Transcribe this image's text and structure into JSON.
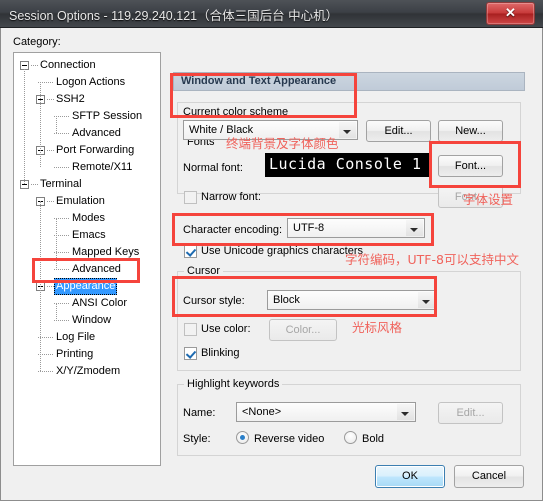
{
  "window": {
    "title": "Session Options - 119.29.240.121（合体三国后台 中心机）",
    "close_label": "✕",
    "close_icon": "close-icon"
  },
  "category": {
    "label": "Category:",
    "items": [
      {
        "label": "Connection",
        "indent": 0,
        "expander": true,
        "selected": false
      },
      {
        "label": "Logon Actions",
        "indent": 1,
        "expander": false,
        "selected": false
      },
      {
        "label": "SSH2",
        "indent": 1,
        "expander": true,
        "selected": false
      },
      {
        "label": "SFTP Session",
        "indent": 2,
        "expander": false,
        "selected": false
      },
      {
        "label": "Advanced",
        "indent": 2,
        "expander": false,
        "selected": false
      },
      {
        "label": "Port Forwarding",
        "indent": 1,
        "expander": true,
        "selected": false
      },
      {
        "label": "Remote/X11",
        "indent": 2,
        "expander": false,
        "selected": false
      },
      {
        "label": "Terminal",
        "indent": 0,
        "expander": true,
        "selected": false
      },
      {
        "label": "Emulation",
        "indent": 1,
        "expander": true,
        "selected": false
      },
      {
        "label": "Modes",
        "indent": 2,
        "expander": false,
        "selected": false
      },
      {
        "label": "Emacs",
        "indent": 2,
        "expander": false,
        "selected": false
      },
      {
        "label": "Mapped Keys",
        "indent": 2,
        "expander": false,
        "selected": false
      },
      {
        "label": "Advanced",
        "indent": 2,
        "expander": false,
        "selected": false
      },
      {
        "label": "Appearance",
        "indent": 1,
        "expander": true,
        "selected": true
      },
      {
        "label": "ANSI Color",
        "indent": 2,
        "expander": false,
        "selected": false
      },
      {
        "label": "Window",
        "indent": 2,
        "expander": false,
        "selected": false
      },
      {
        "label": "Log File",
        "indent": 1,
        "expander": false,
        "selected": false
      },
      {
        "label": "Printing",
        "indent": 1,
        "expander": false,
        "selected": false
      },
      {
        "label": "X/Y/Zmodem",
        "indent": 1,
        "expander": false,
        "selected": false
      }
    ]
  },
  "pane": {
    "header": "Window and Text Appearance",
    "color_scheme": {
      "group_label": "Current color scheme",
      "value": "White / Black",
      "edit_button": "Edit...",
      "new_button": "New..."
    },
    "fonts": {
      "group_label": "Fonts",
      "normal_font_label": "Normal font:",
      "normal_font_preview": "Lucida Console 1",
      "font_button": "Font...",
      "narrow_font_label": "Narrow font:",
      "narrow_font_checked": false,
      "narrow_font_button": "Font...",
      "encoding_label": "Character encoding:",
      "encoding_value": "UTF-8",
      "unicode_graphics_label": "Use Unicode graphics characters",
      "unicode_graphics_checked": true
    },
    "cursor": {
      "group_label": "Cursor",
      "style_label": "Cursor style:",
      "style_value": "Block",
      "use_color_label": "Use color:",
      "use_color_checked": false,
      "color_button": "Color...",
      "blinking_label": "Blinking",
      "blinking_checked": true
    },
    "highlight": {
      "group_label": "Highlight keywords",
      "name_label": "Name:",
      "name_value": "<None>",
      "edit_button": "Edit...",
      "style_label": "Style:",
      "reverse_video_label": "Reverse video",
      "reverse_video_selected": true,
      "bold_label": "Bold",
      "bold_selected": false
    }
  },
  "footer": {
    "ok_label": "OK",
    "cancel_label": "Cancel"
  },
  "annotations": {
    "note_color_scheme": "终端背景及字体颜色",
    "note_font_setting": "字体设置",
    "note_encoding": "字符编码，UTF-8可以支持中文",
    "note_cursor": "光标风格",
    "highlight_color": "#f5443c"
  }
}
